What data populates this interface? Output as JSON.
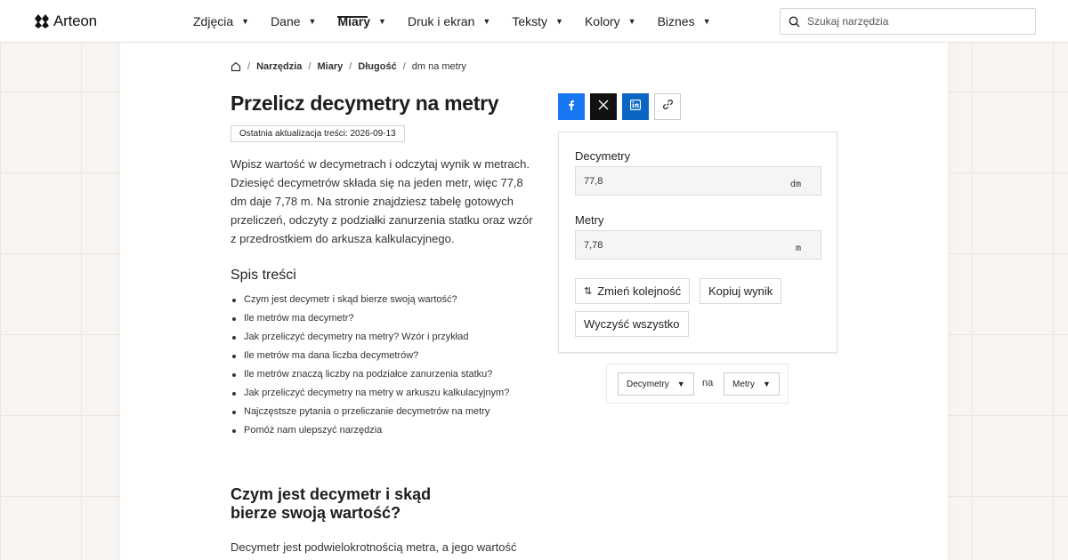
{
  "brand": {
    "name": "Arteon"
  },
  "nav": [
    {
      "label": "Zdjęcia",
      "active": false
    },
    {
      "label": "Dane",
      "active": false
    },
    {
      "label": "Miary",
      "active": true
    },
    {
      "label": "Druk i ekran",
      "active": false
    },
    {
      "label": "Teksty",
      "active": false
    },
    {
      "label": "Kolory",
      "active": false
    },
    {
      "label": "Biznes",
      "active": false
    }
  ],
  "search": {
    "placeholder": "Szukaj narzędzia",
    "icon": "search-icon"
  },
  "breadcrumb": {
    "home_icon": "home-icon",
    "items": [
      "Narzędzia",
      "Miary",
      "Długość",
      "dm na metry"
    ]
  },
  "page": {
    "title": "Przelicz decymetry na metry",
    "updated": "Ostatnia aktualizacja treści: 2026-09-13",
    "intro": "Wpisz wartość w decymetrach i odczytaj wynik w metrach. Dziesięć decymetrów składa się na jeden metr, więc 77,8 dm daje 7,78 m. Na stronie znajdziesz tabelę gotowych przeliczeń, odczyty z podziałki zanurzenia statku oraz wzór z przedrostkiem do arkusza kalkulacyjnego."
  },
  "toc": {
    "title": "Spis treści",
    "items": [
      "Czym jest decymetr i skąd bierze swoją wartość?",
      "Ile metrów ma decymetr?",
      "Jak przeliczyć decymetry na metry? Wzór i przykład",
      "Ile metrów ma dana liczba decymetrów?",
      "Ile metrów znaczą liczby na podziałce zanurzenia statku?",
      "Jak przeliczyć decymetry na metry w arkuszu kalkulacyjnym?",
      "Najczęstsze pytania o przeliczanie decymetrów na metry",
      "Pomóż nam ulepszyć narzędzia"
    ]
  },
  "section1": {
    "title": "Czym jest decymetr i skąd bierze swoją wartość?",
    "text": "Decymetr jest podwielokrotnością metra, a jego wartość"
  },
  "share": {
    "icons": [
      "facebook-icon",
      "x-icon",
      "linkedin-icon",
      "link-icon"
    ],
    "colors": {
      "facebook": "#1877f2",
      "x": "#111111",
      "linkedin": "#0a66c2"
    }
  },
  "converter": {
    "from_label": "Decymetry",
    "from_value": "77,8",
    "from_unit": "dm",
    "to_label": "Metry",
    "to_value": "7,78",
    "to_unit": "m",
    "swap_label": "Zmień kolejność",
    "copy_label": "Kopiuj wynik",
    "clear_label": "Wyczyść wszystko"
  },
  "unit_selector": {
    "from": "Decymetry",
    "connector": "na",
    "to": "Metry"
  }
}
